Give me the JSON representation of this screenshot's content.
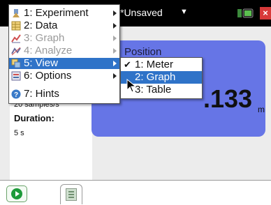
{
  "titlebar": {
    "document": "*Unsaved",
    "caret": "▼",
    "close": "×"
  },
  "info": {
    "samples": "20 samples/s",
    "duration_label": "Duration:",
    "duration_value": "5 s"
  },
  "meter": {
    "label": "Position",
    "value": ".133",
    "unit": "m",
    "color": "#6675e6"
  },
  "menu": {
    "items": [
      {
        "label": "1: Experiment",
        "icon": "experiment-icon",
        "enabled": true,
        "submenu": true
      },
      {
        "label": "2: Data",
        "icon": "data-table-icon",
        "enabled": true,
        "submenu": true
      },
      {
        "label": "3: Graph",
        "icon": "graph-icon",
        "enabled": false,
        "submenu": true
      },
      {
        "label": "4: Analyze",
        "icon": "analyze-icon",
        "enabled": false,
        "submenu": true
      },
      {
        "label": "5: View",
        "icon": "view-icon",
        "enabled": true,
        "submenu": true,
        "selected": true
      },
      {
        "label": "6: Options",
        "icon": "options-icon",
        "enabled": true,
        "submenu": true
      },
      {
        "label": "7: Hints",
        "icon": "help-icon",
        "enabled": true,
        "submenu": false
      }
    ],
    "selection_color": "#2f73c8"
  },
  "submenu": {
    "items": [
      {
        "label": "1: Meter",
        "checked": true
      },
      {
        "label": "2: Graph",
        "checked": false,
        "selected": true
      },
      {
        "label": "3: Table",
        "checked": false
      }
    ],
    "check_mark": "✔"
  },
  "tabs": {
    "run": "run-icon",
    "page": "page-icon"
  }
}
